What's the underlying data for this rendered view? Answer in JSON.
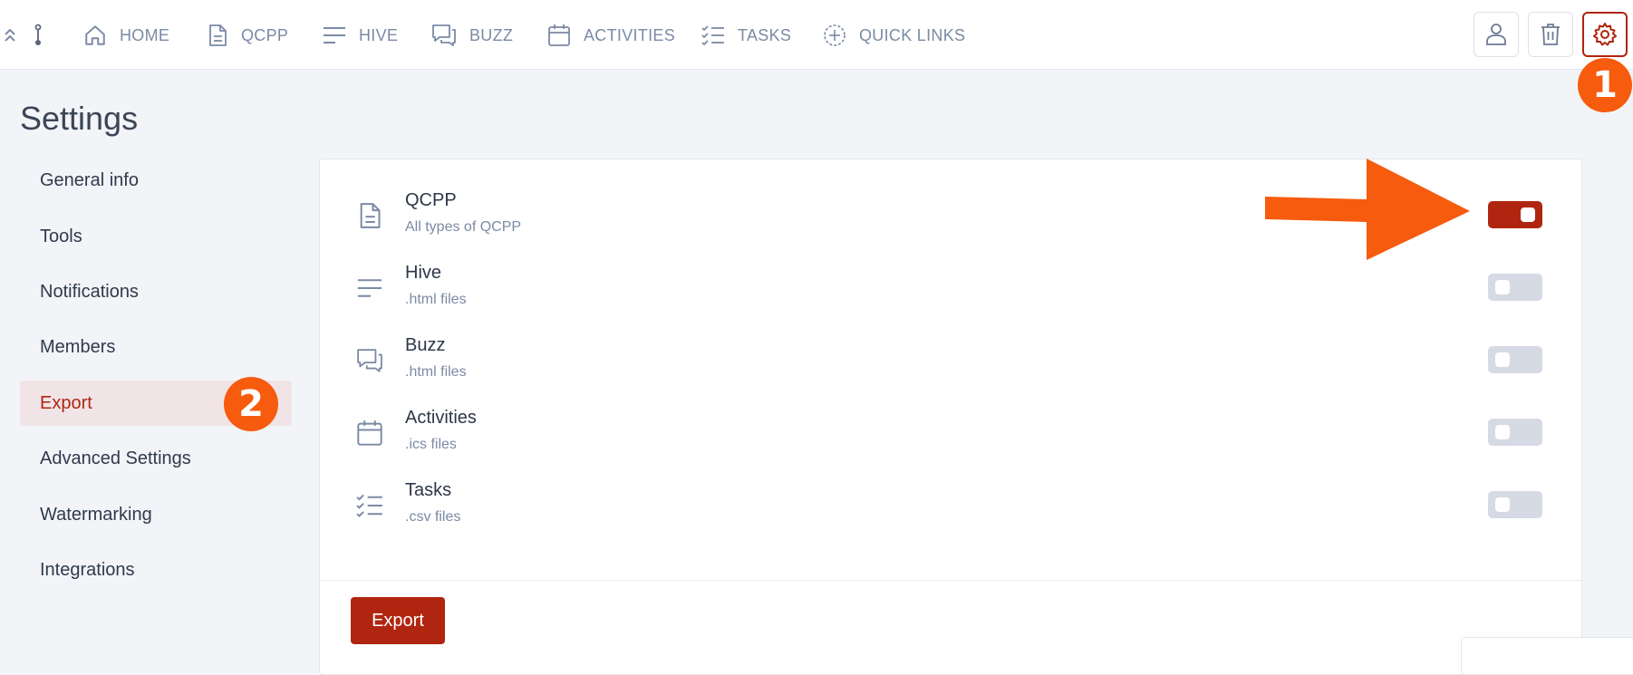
{
  "nav": {
    "items": [
      {
        "label": "HOME",
        "icon": "home-icon"
      },
      {
        "label": "QCPP",
        "icon": "document-icon"
      },
      {
        "label": "HIVE",
        "icon": "lines-icon"
      },
      {
        "label": "BUZZ",
        "icon": "chat-icon"
      },
      {
        "label": "ACTIVITIES",
        "icon": "calendar-icon"
      },
      {
        "label": "TASKS",
        "icon": "checklist-icon"
      },
      {
        "label": "QUICK LINKS",
        "icon": "plus-circle-icon"
      }
    ],
    "right_icons": [
      "user-icon",
      "trash-icon",
      "gear-icon"
    ]
  },
  "annotations": {
    "step1": "1",
    "step2": "2"
  },
  "page": {
    "title": "Settings"
  },
  "sidebar": {
    "items": [
      {
        "label": "General info"
      },
      {
        "label": "Tools"
      },
      {
        "label": "Notifications"
      },
      {
        "label": "Members"
      },
      {
        "label": "Export",
        "active": true
      },
      {
        "label": "Advanced Settings"
      },
      {
        "label": "Watermarking"
      },
      {
        "label": "Integrations"
      }
    ]
  },
  "export": {
    "rows": [
      {
        "title": "QCPP",
        "subtitle": "All types of QCPP",
        "icon": "document-icon",
        "enabled": true
      },
      {
        "title": "Hive",
        "subtitle": ".html files",
        "icon": "lines-icon",
        "enabled": false
      },
      {
        "title": "Buzz",
        "subtitle": ".html files",
        "icon": "chat-icon",
        "enabled": false
      },
      {
        "title": "Activities",
        "subtitle": ".ics files",
        "icon": "calendar-icon",
        "enabled": false
      },
      {
        "title": "Tasks",
        "subtitle": ".csv files",
        "icon": "checklist-icon",
        "enabled": false
      }
    ],
    "button_label": "Export"
  },
  "colors": {
    "accent": "#b0250f",
    "annotation": "#f65b0e",
    "muted": "#7b8aa5",
    "toggle_off": "#d5dae4"
  }
}
